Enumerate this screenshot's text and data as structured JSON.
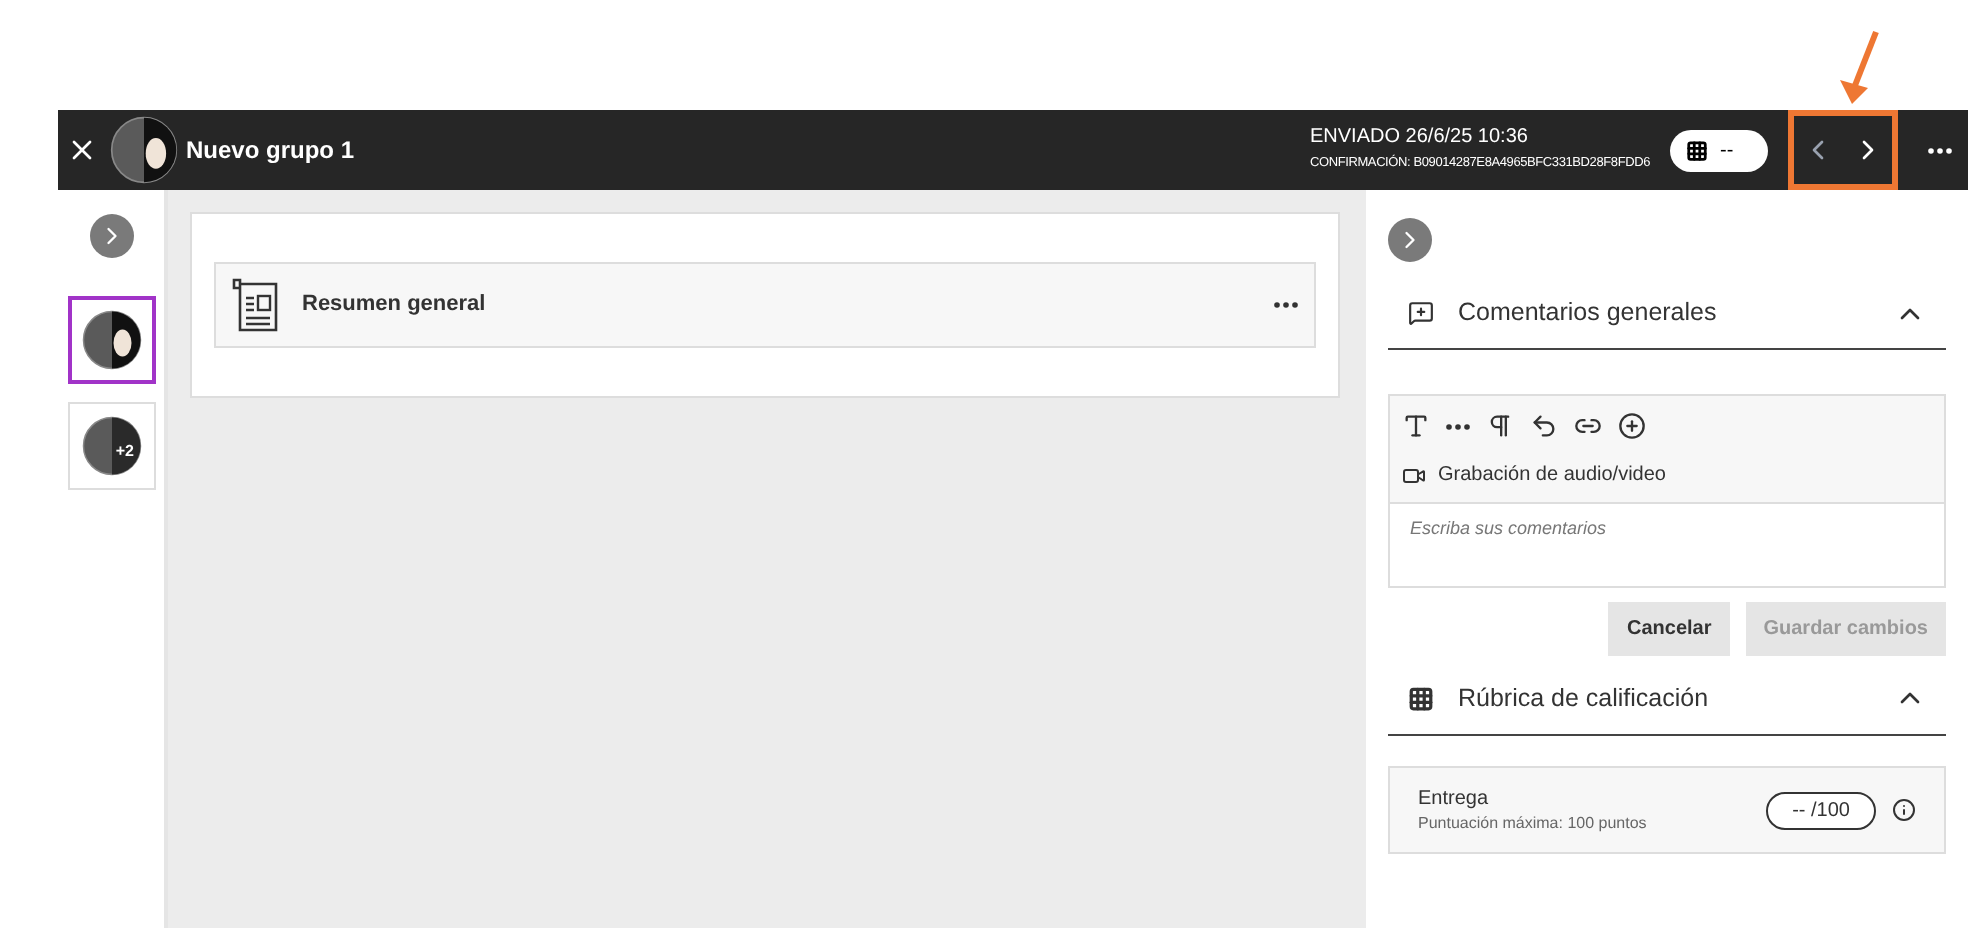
{
  "header": {
    "title": "Nuevo grupo 1",
    "submitted": "ENVIADO 26/6/25 10:36",
    "confirmation": "CONFIRMACIÓN: B09014287E8A4965BFC331BD28F8FDD6",
    "grade_pill": "--",
    "nav_highlighted": true
  },
  "sidebar": {
    "members": [
      {
        "selected": true
      },
      {
        "selected": false,
        "badge": "+2"
      }
    ]
  },
  "main": {
    "items": [
      {
        "title": "Resumen general"
      }
    ]
  },
  "panel": {
    "feedback": {
      "title": "Comentarios generales",
      "expanded": true,
      "media_button": "Grabación de audio/video",
      "placeholder": "Escriba sus comentarios",
      "buttons": [
        {
          "label": "Cancelar",
          "disabled": false
        },
        {
          "label": "Guardar cambios",
          "disabled": true
        }
      ]
    },
    "rubric": {
      "title": "Rúbrica de calificación",
      "expanded": true,
      "criterion": "Entrega",
      "max": "Puntuación máxima: 100 puntos",
      "score": "-- /100"
    }
  }
}
